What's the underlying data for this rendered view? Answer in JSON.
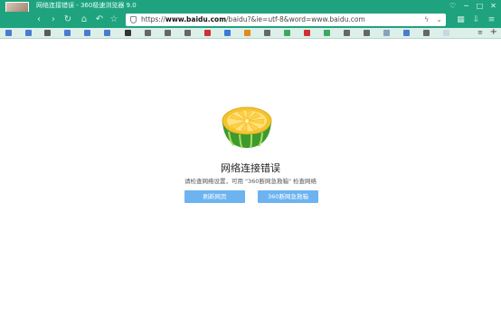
{
  "window": {
    "title": "网络连接错误 - 360极速浏览器 9.0",
    "controls": [
      "♡",
      "─",
      "□",
      "✕"
    ]
  },
  "nav": {
    "back": "‹",
    "forward": "›",
    "reload": "↻",
    "home": "⌂",
    "undo": "↶",
    "star": "☆",
    "url_prefix": "https://",
    "url_domain": "www.baidu.com",
    "url_rest": "/baidu?&ie=utf-8&word=www.baidu.com",
    "url_icons": [
      "ϟ",
      "⌄"
    ],
    "right_icons": [
      "▦",
      "⇩",
      "≡"
    ]
  },
  "tabbar": {
    "new_tab": "+",
    "list": "≡"
  },
  "error_page": {
    "title": "网络连接错误",
    "description": "请检查网络设置，可用 \"360断网急救箱\" 检查网络",
    "refresh_button": "刷新网页",
    "firstaid_button": "360断网急救箱"
  },
  "colors": {
    "accent": "#1fa37f",
    "button": "#6cb3f0"
  }
}
